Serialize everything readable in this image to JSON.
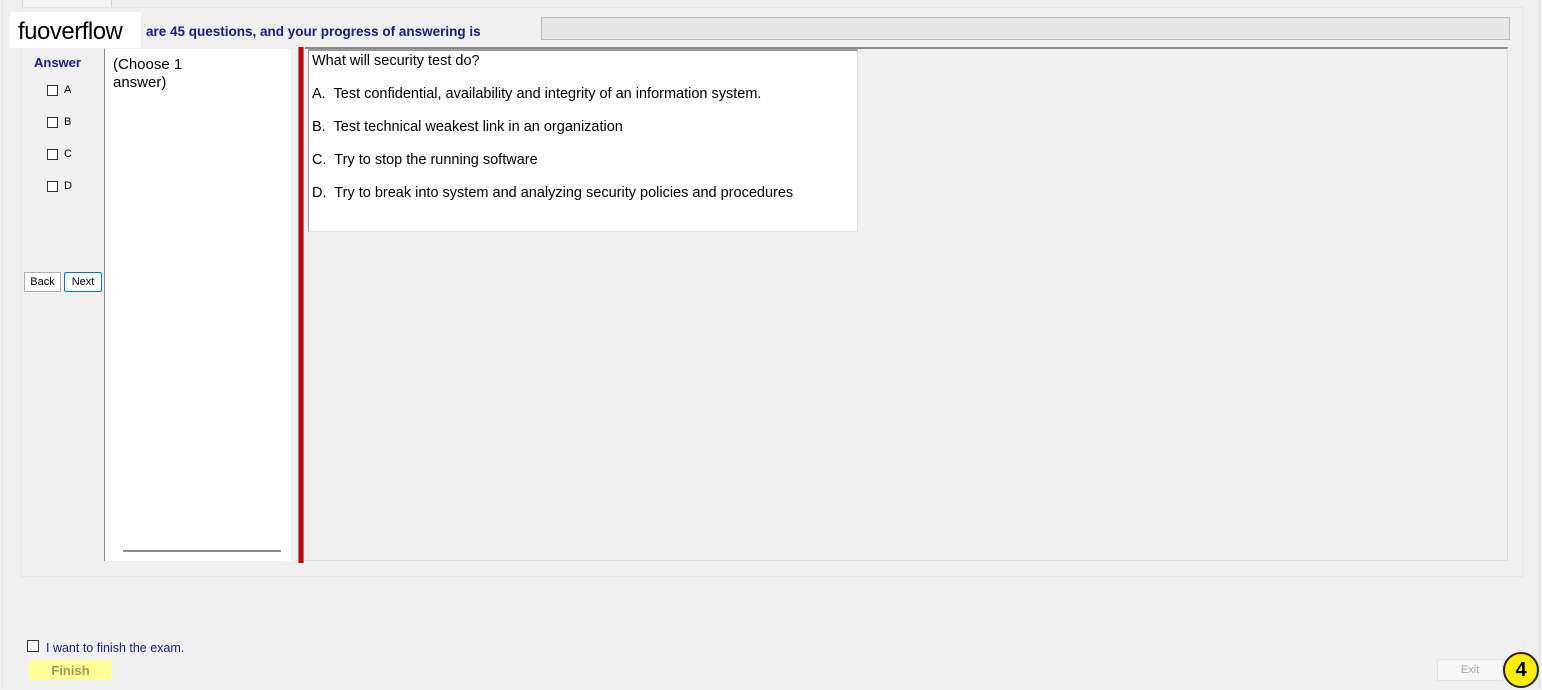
{
  "logo": {
    "text": "fuoverflow"
  },
  "header": {
    "progress_label": "are 45 questions, and your progress of answering is",
    "progress_fraction": 0
  },
  "answer_panel": {
    "heading": "Answer",
    "options": [
      "A",
      "B",
      "C",
      "D"
    ],
    "checked": [
      false,
      false,
      false,
      false
    ]
  },
  "navigation": {
    "back_label": "Back",
    "next_label": "Next"
  },
  "instruction": {
    "line1": "(Choose 1",
    "line2": "answer)"
  },
  "question": {
    "text": "What will security test do?",
    "choices": [
      {
        "letter": "A.",
        "text": "Test confidential, availability and integrity of an information system."
      },
      {
        "letter": "B.",
        "text": "Test technical weakest link in an organization"
      },
      {
        "letter": "C.",
        "text": "Try to stop the running software"
      },
      {
        "letter": "D.",
        "text": "Try to break into system and analyzing security policies and procedures"
      }
    ]
  },
  "footer": {
    "finish_check_label": "I want to finish the exam.",
    "finish_button_label": "Finish",
    "exit_button_label": "Exit",
    "badge_value": "4"
  },
  "colors": {
    "accent_text": "#1a1a8c",
    "splitter": "#d40000",
    "finish_button_bg": "#ffff99",
    "badge_bg": "#ffee00"
  }
}
